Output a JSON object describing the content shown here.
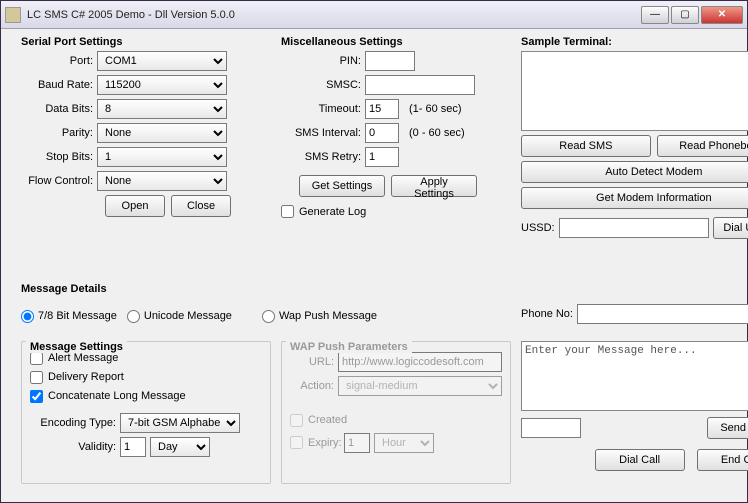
{
  "window": {
    "title": "LC SMS C# 2005 Demo - Dll Version 5.0.0"
  },
  "serial": {
    "legend": "Serial Port Settings",
    "portLabel": "Port:",
    "port": "COM1",
    "baudLabel": "Baud Rate:",
    "baud": "115200",
    "dataBitsLabel": "Data Bits:",
    "dataBits": "8",
    "parityLabel": "Parity:",
    "parity": "None",
    "stopBitsLabel": "Stop Bits:",
    "stopBits": "1",
    "flowLabel": "Flow Control:",
    "flow": "None",
    "openBtn": "Open",
    "closeBtn": "Close"
  },
  "misc": {
    "legend": "Miscellaneous Settings",
    "pinLabel": "PIN:",
    "pin": "",
    "smscLabel": "SMSC:",
    "smsc": "",
    "timeoutLabel": "Timeout:",
    "timeout": "15",
    "timeoutHint": "(1- 60 sec)",
    "intervalLabel": "SMS Interval:",
    "interval": "0",
    "intervalHint": "(0 - 60 sec)",
    "retryLabel": "SMS Retry:",
    "retry": "1",
    "getBtn": "Get Settings",
    "applyBtn": "Apply Settings",
    "genLog": "Generate Log"
  },
  "terminal": {
    "legend": "Sample Terminal:",
    "readSms": "Read SMS",
    "readPb": "Read Phonebook",
    "autoDetect": "Auto Detect Modem",
    "getModem": "Get Modem Information",
    "ussdLabel": "USSD:",
    "ussd": "",
    "dialUssd": "Dial USSD"
  },
  "details": {
    "legend": "Message Details",
    "r78": "7/8 Bit Message",
    "rUnicode": "Unicode Message",
    "rWap": "Wap Push Message",
    "msgSettingsLegend": "Message Settings",
    "alert": "Alert Message",
    "delivery": "Delivery Report",
    "concat": "Concatenate Long Message",
    "encLabel": "Encoding Type:",
    "enc": "7-bit GSM Alphabet",
    "validityLabel": "Validity:",
    "validityNum": "1",
    "validityUnit": "Day",
    "wapLegend": "WAP Push Parameters",
    "urlLabel": "URL:",
    "url": "http://www.logiccodesoft.com",
    "actionLabel": "Action:",
    "action": "signal-medium",
    "created": "Created",
    "expiry": "Expiry:",
    "expiryNum": "1",
    "expiryUnit": "Hour",
    "phoneLabel": "Phone No:",
    "phone": "",
    "msgPlaceholder": "Enter your Message here...",
    "status": "",
    "sendBtn": "Send SMS",
    "dialBtn": "Dial Call",
    "endBtn": "End Call"
  }
}
